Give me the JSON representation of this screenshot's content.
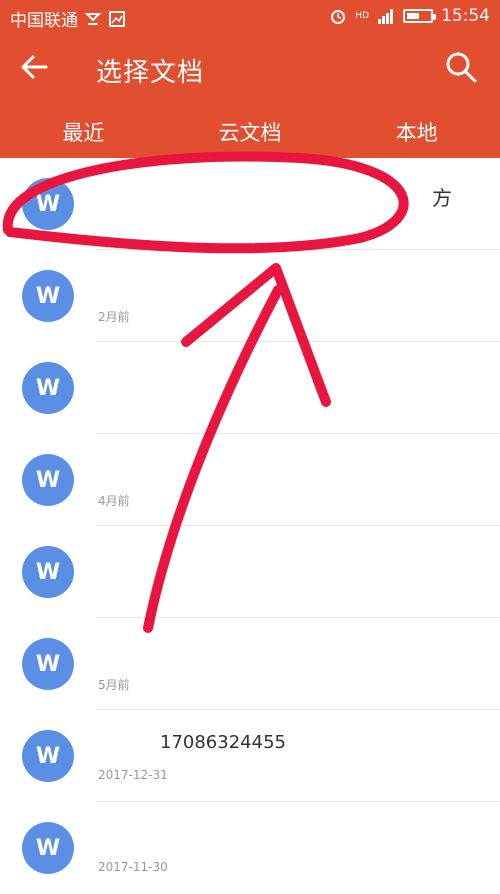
{
  "status_bar": {
    "carrier": "中国联通",
    "time": "15:54",
    "network_label": "HD",
    "battery_level": 0.55
  },
  "app_bar": {
    "title": "选择文档"
  },
  "tabs": [
    {
      "label": "最近"
    },
    {
      "label": "云文档"
    },
    {
      "label": "本地"
    }
  ],
  "documents": [
    {
      "icon_letter": "W",
      "name": "",
      "date": "",
      "extra": "方"
    },
    {
      "icon_letter": "W",
      "name": "",
      "date": "2月前",
      "extra": ""
    },
    {
      "icon_letter": "W",
      "name": "",
      "date": "",
      "extra": ""
    },
    {
      "icon_letter": "W",
      "name": "",
      "date": "4月前",
      "extra": ""
    },
    {
      "icon_letter": "W",
      "name": "",
      "date": "",
      "extra": ""
    },
    {
      "icon_letter": "W",
      "name": "",
      "date": "5月前",
      "extra": ""
    },
    {
      "icon_letter": "W",
      "name": "17086324455",
      "date": "2017-12-31",
      "extra": ""
    },
    {
      "icon_letter": "W",
      "name": "",
      "date": "2017-11-30",
      "extra": ""
    }
  ],
  "colors": {
    "header_bg": "#e24f30",
    "avatar_bg": "#5b8fe6",
    "annotation_red": "#e8163f"
  }
}
